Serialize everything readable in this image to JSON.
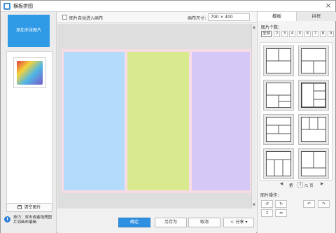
{
  "window": {
    "title": "横板拼图",
    "close_glyph": "×"
  },
  "left_panel": {
    "add_button_label": "添加多张图片",
    "clear_button_label": "清空图片",
    "tip_text": "技巧：双击或者拖拽图片到画布编辑",
    "info_glyph": "i"
  },
  "toolbar": {
    "auto_add_label": "图片自动进入画布",
    "canvas_size_label": "画布尺寸：",
    "canvas_size_value": "790 × 400"
  },
  "canvas": {
    "cell_colors": [
      "#b4dcfa",
      "#d8e98e",
      "#d4c8f6"
    ]
  },
  "bottom_bar": {
    "ok_label": "确定",
    "save_as_label": "另存为",
    "cancel_label": "取消",
    "share_label": "分享",
    "share_arrow": "▾",
    "share_glyph": "<"
  },
  "right_panel": {
    "tabs": [
      "模板",
      "拼框"
    ],
    "count_label": "图片个数：",
    "count_options": [
      "全部",
      "2",
      "3",
      "4",
      "5",
      "6",
      "7",
      "8",
      "9"
    ],
    "pager": {
      "prev": "◀",
      "page_prefix": "第",
      "page": "1",
      "page_suffix": "/1 页",
      "next": "▶"
    },
    "ops_label": "图片操作：",
    "tool_glyphs": [
      "↺",
      "↻",
      "↶",
      "↷",
      "↕",
      "⇔"
    ]
  }
}
